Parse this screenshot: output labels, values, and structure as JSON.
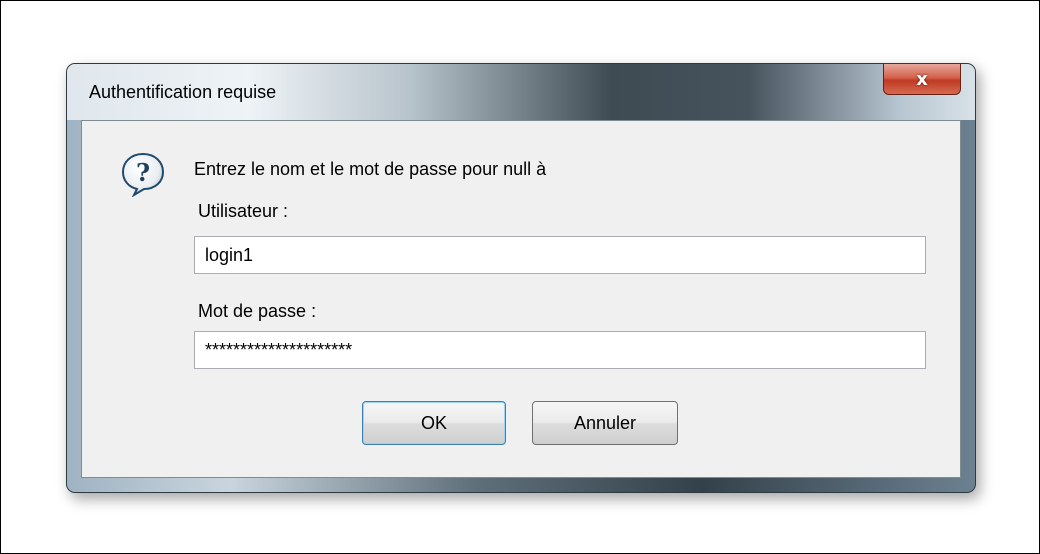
{
  "dialog": {
    "title": "Authentification requise",
    "close_icon_glyph": "x",
    "icon": "help-question-icon",
    "prompt": "Entrez le nom et le mot de passe pour null à",
    "username_label": "Utilisateur :",
    "username_value": "login1",
    "password_label": "Mot de passe :",
    "password_value": "*********************",
    "ok_label": "OK",
    "cancel_label": "Annuler"
  },
  "colors": {
    "close_button": "#c8452c",
    "content_bg": "#f0f0f0",
    "ok_focus_border": "#3c7fb1"
  }
}
